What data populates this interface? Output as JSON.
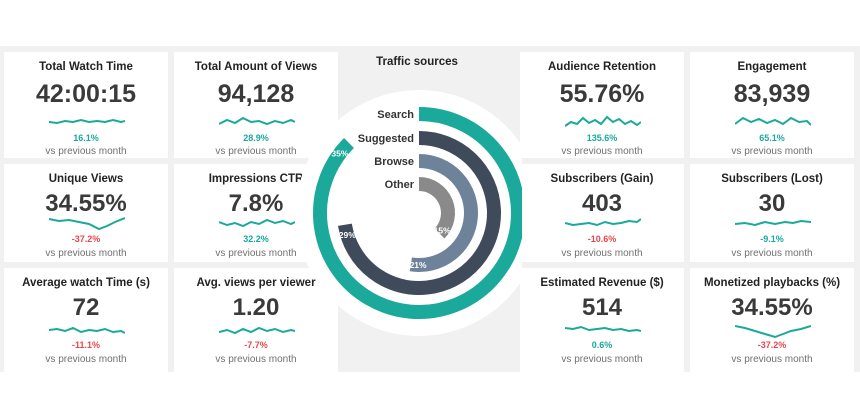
{
  "colors": {
    "accent": "#1aa99a",
    "negative": "#e8474b",
    "search": "#1aa99a",
    "suggested": "#3f4b5b",
    "browse": "#6e8399",
    "other": "#8a8a8a"
  },
  "traffic": {
    "title": "Traffic sources",
    "sources": [
      {
        "label": "Search",
        "pct_label": "35%",
        "value": 35
      },
      {
        "label": "Suggested",
        "pct_label": "29%",
        "value": 29
      },
      {
        "label": "Browse",
        "pct_label": "21%",
        "value": 21
      },
      {
        "label": "Other",
        "pct_label": "15%",
        "value": 15
      }
    ]
  },
  "cards": {
    "total_watch_time": {
      "title": "Total Watch Time",
      "value": "42:00:15",
      "change": "16.1%",
      "note": "vs previous month"
    },
    "total_views": {
      "title": "Total Amount of Views",
      "value": "94,128",
      "change": "28.9%",
      "note": "vs previous month"
    },
    "audience_retention": {
      "title": "Audience Retention",
      "value": "55.76%",
      "change": "135.6%",
      "note": "vs previous month"
    },
    "engagement": {
      "title": "Engagement",
      "value": "83,939",
      "change": "65.1%",
      "note": "vs previous month"
    },
    "unique_views": {
      "title": "Unique Views",
      "value": "34.55%",
      "change": "-37.2%",
      "note": "vs previous month"
    },
    "impressions_ctr": {
      "title": "Impressions CTR",
      "value": "7.8%",
      "change": "32.2%",
      "note": "vs previous month"
    },
    "subscribers_gain": {
      "title": "Subscribers (Gain)",
      "value": "403",
      "change": "-10.6%",
      "note": "vs previous month"
    },
    "subscribers_lost": {
      "title": "Subscribers (Lost)",
      "value": "30",
      "change": "-9.1%",
      "note": "vs previous month"
    },
    "avg_watch_time": {
      "title": "Average watch Time (s)",
      "value": "72",
      "change": "-11.1%",
      "note": "vs previous month"
    },
    "avg_views_per_viewer": {
      "title": "Avg. views per viewer",
      "value": "1.20",
      "change": "-7.7%",
      "note": "vs previous month"
    },
    "estimated_revenue": {
      "title": "Estimated Revenue ($)",
      "value": "514",
      "change": "0.6%",
      "note": "vs previous month"
    },
    "monetized_playbacks": {
      "title": "Monetized playbacks (%)",
      "value": "34.55%",
      "change": "-37.2%",
      "note": "vs previous month"
    }
  }
}
